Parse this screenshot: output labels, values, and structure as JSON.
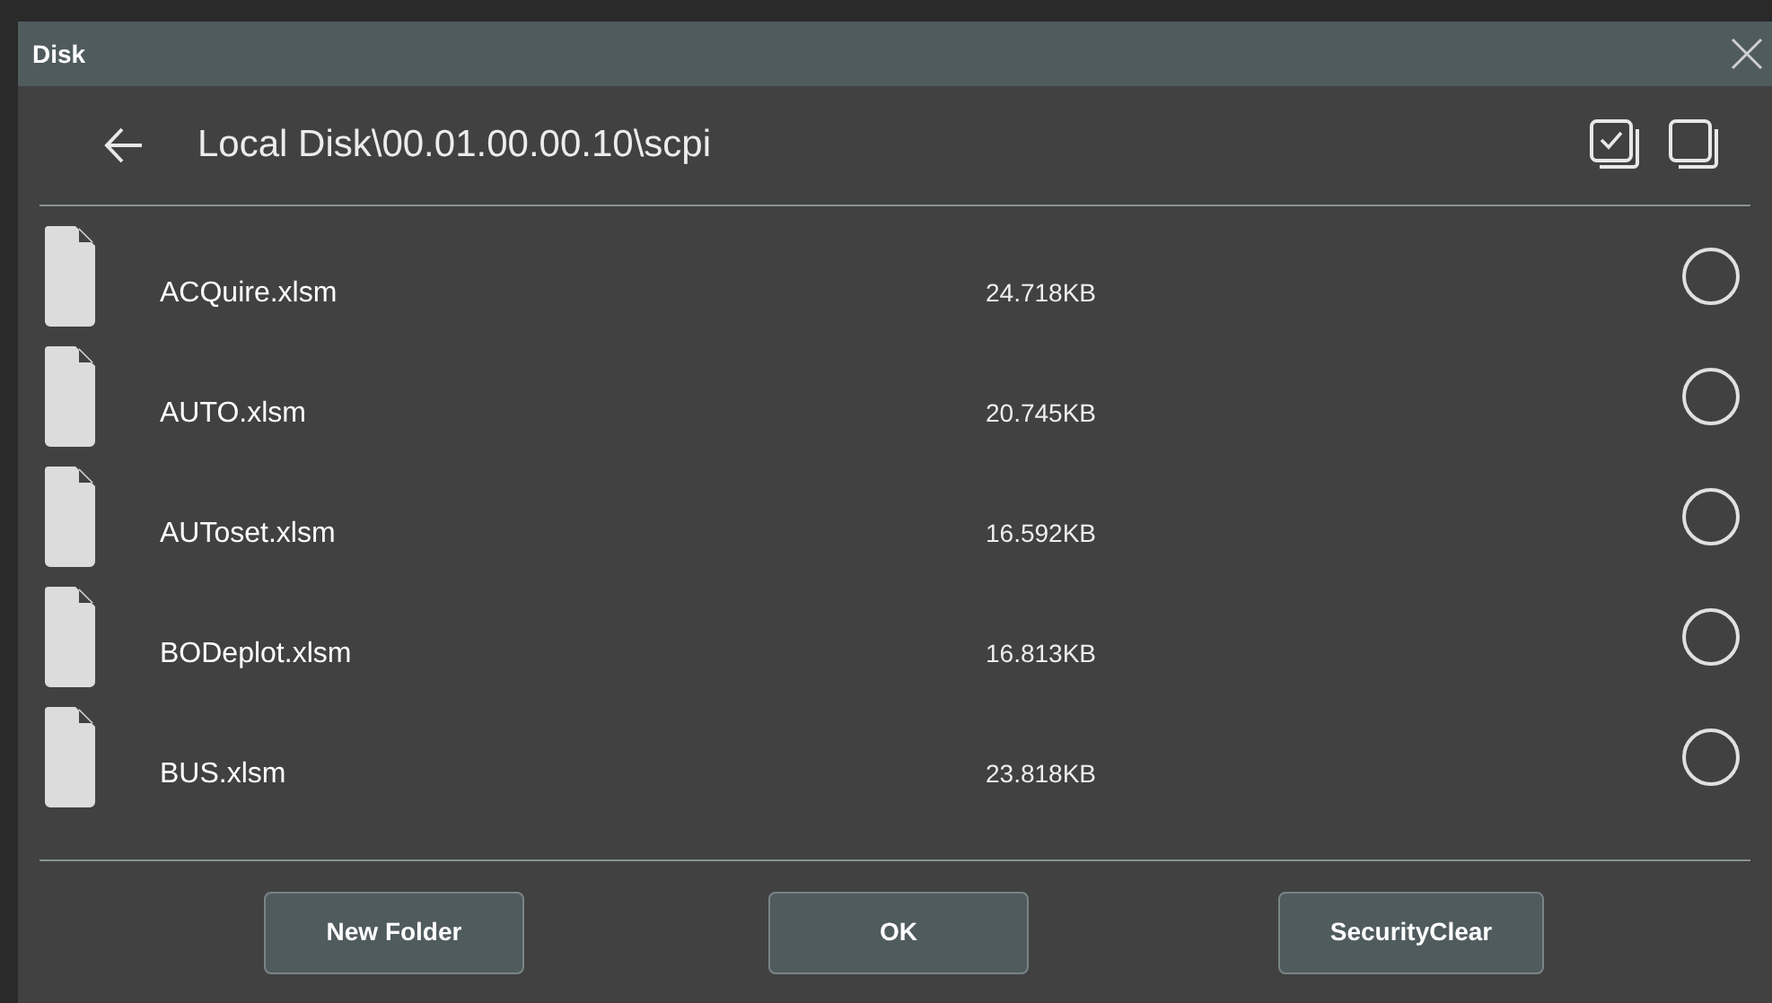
{
  "window": {
    "title": "Disk"
  },
  "path": "Local Disk\\00.01.00.00.10\\scpi",
  "files": [
    {
      "name": "ACQuire.xlsm",
      "size": "24.718KB",
      "selected": false
    },
    {
      "name": "AUTO.xlsm",
      "size": "20.745KB",
      "selected": false
    },
    {
      "name": "AUToset.xlsm",
      "size": "16.592KB",
      "selected": false
    },
    {
      "name": "BODeplot.xlsm",
      "size": "16.813KB",
      "selected": false
    },
    {
      "name": "BUS.xlsm",
      "size": "23.818KB",
      "selected": false
    }
  ],
  "buttons": [
    "New Folder",
    "OK",
    "SecurityClear"
  ]
}
